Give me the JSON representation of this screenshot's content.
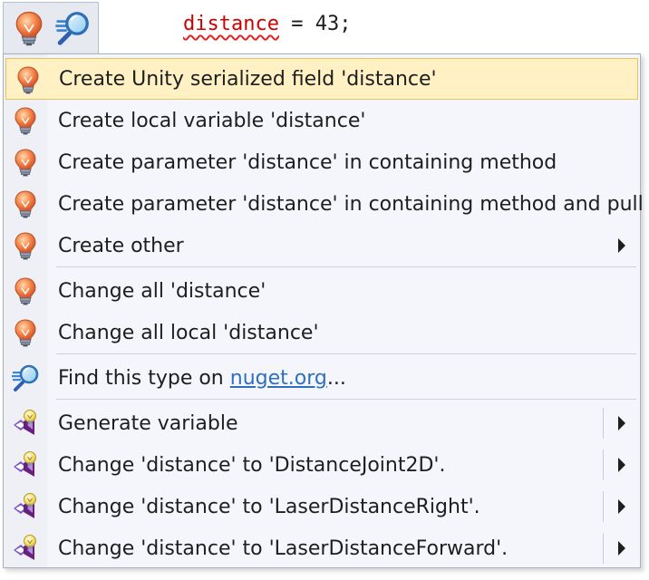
{
  "editor": {
    "identifier": "distance",
    "rest": " = 43;"
  },
  "menu": {
    "items": [
      {
        "label": "Create Unity serialized field 'distance'",
        "icon": "lightbulb-icon",
        "selected": true
      },
      {
        "label": "Create local variable 'distance'",
        "icon": "lightbulb-icon"
      },
      {
        "label": "Create parameter 'distance' in containing method",
        "icon": "lightbulb-icon"
      },
      {
        "label": "Create parameter 'distance' in containing method and pull",
        "icon": "lightbulb-icon"
      },
      {
        "label": "Create other",
        "icon": "lightbulb-icon",
        "submenu": true
      },
      {
        "label": "Change all 'distance'",
        "icon": "lightbulb-icon"
      },
      {
        "label": "Change all local 'distance'",
        "icon": "lightbulb-icon"
      },
      {
        "label_prefix": "Find this type on ",
        "link": "nuget.org",
        "label_suffix": "...",
        "icon": "magnifier-icon"
      },
      {
        "label": "Generate variable",
        "icon": "visual-studio-bulb-icon",
        "submenu": true
      },
      {
        "label": "Change 'distance' to 'DistanceJoint2D'.",
        "icon": "visual-studio-bulb-icon",
        "submenu": true
      },
      {
        "label": "Change 'distance' to 'LaserDistanceRight'.",
        "icon": "visual-studio-bulb-icon",
        "submenu": true
      },
      {
        "label": "Change 'distance' to 'LaserDistanceForward'.",
        "icon": "visual-studio-bulb-icon",
        "submenu": true
      }
    ]
  },
  "colors": {
    "selected_bg": "#fff1c4",
    "error_text": "#d10000",
    "link": "#2f6fbf"
  }
}
